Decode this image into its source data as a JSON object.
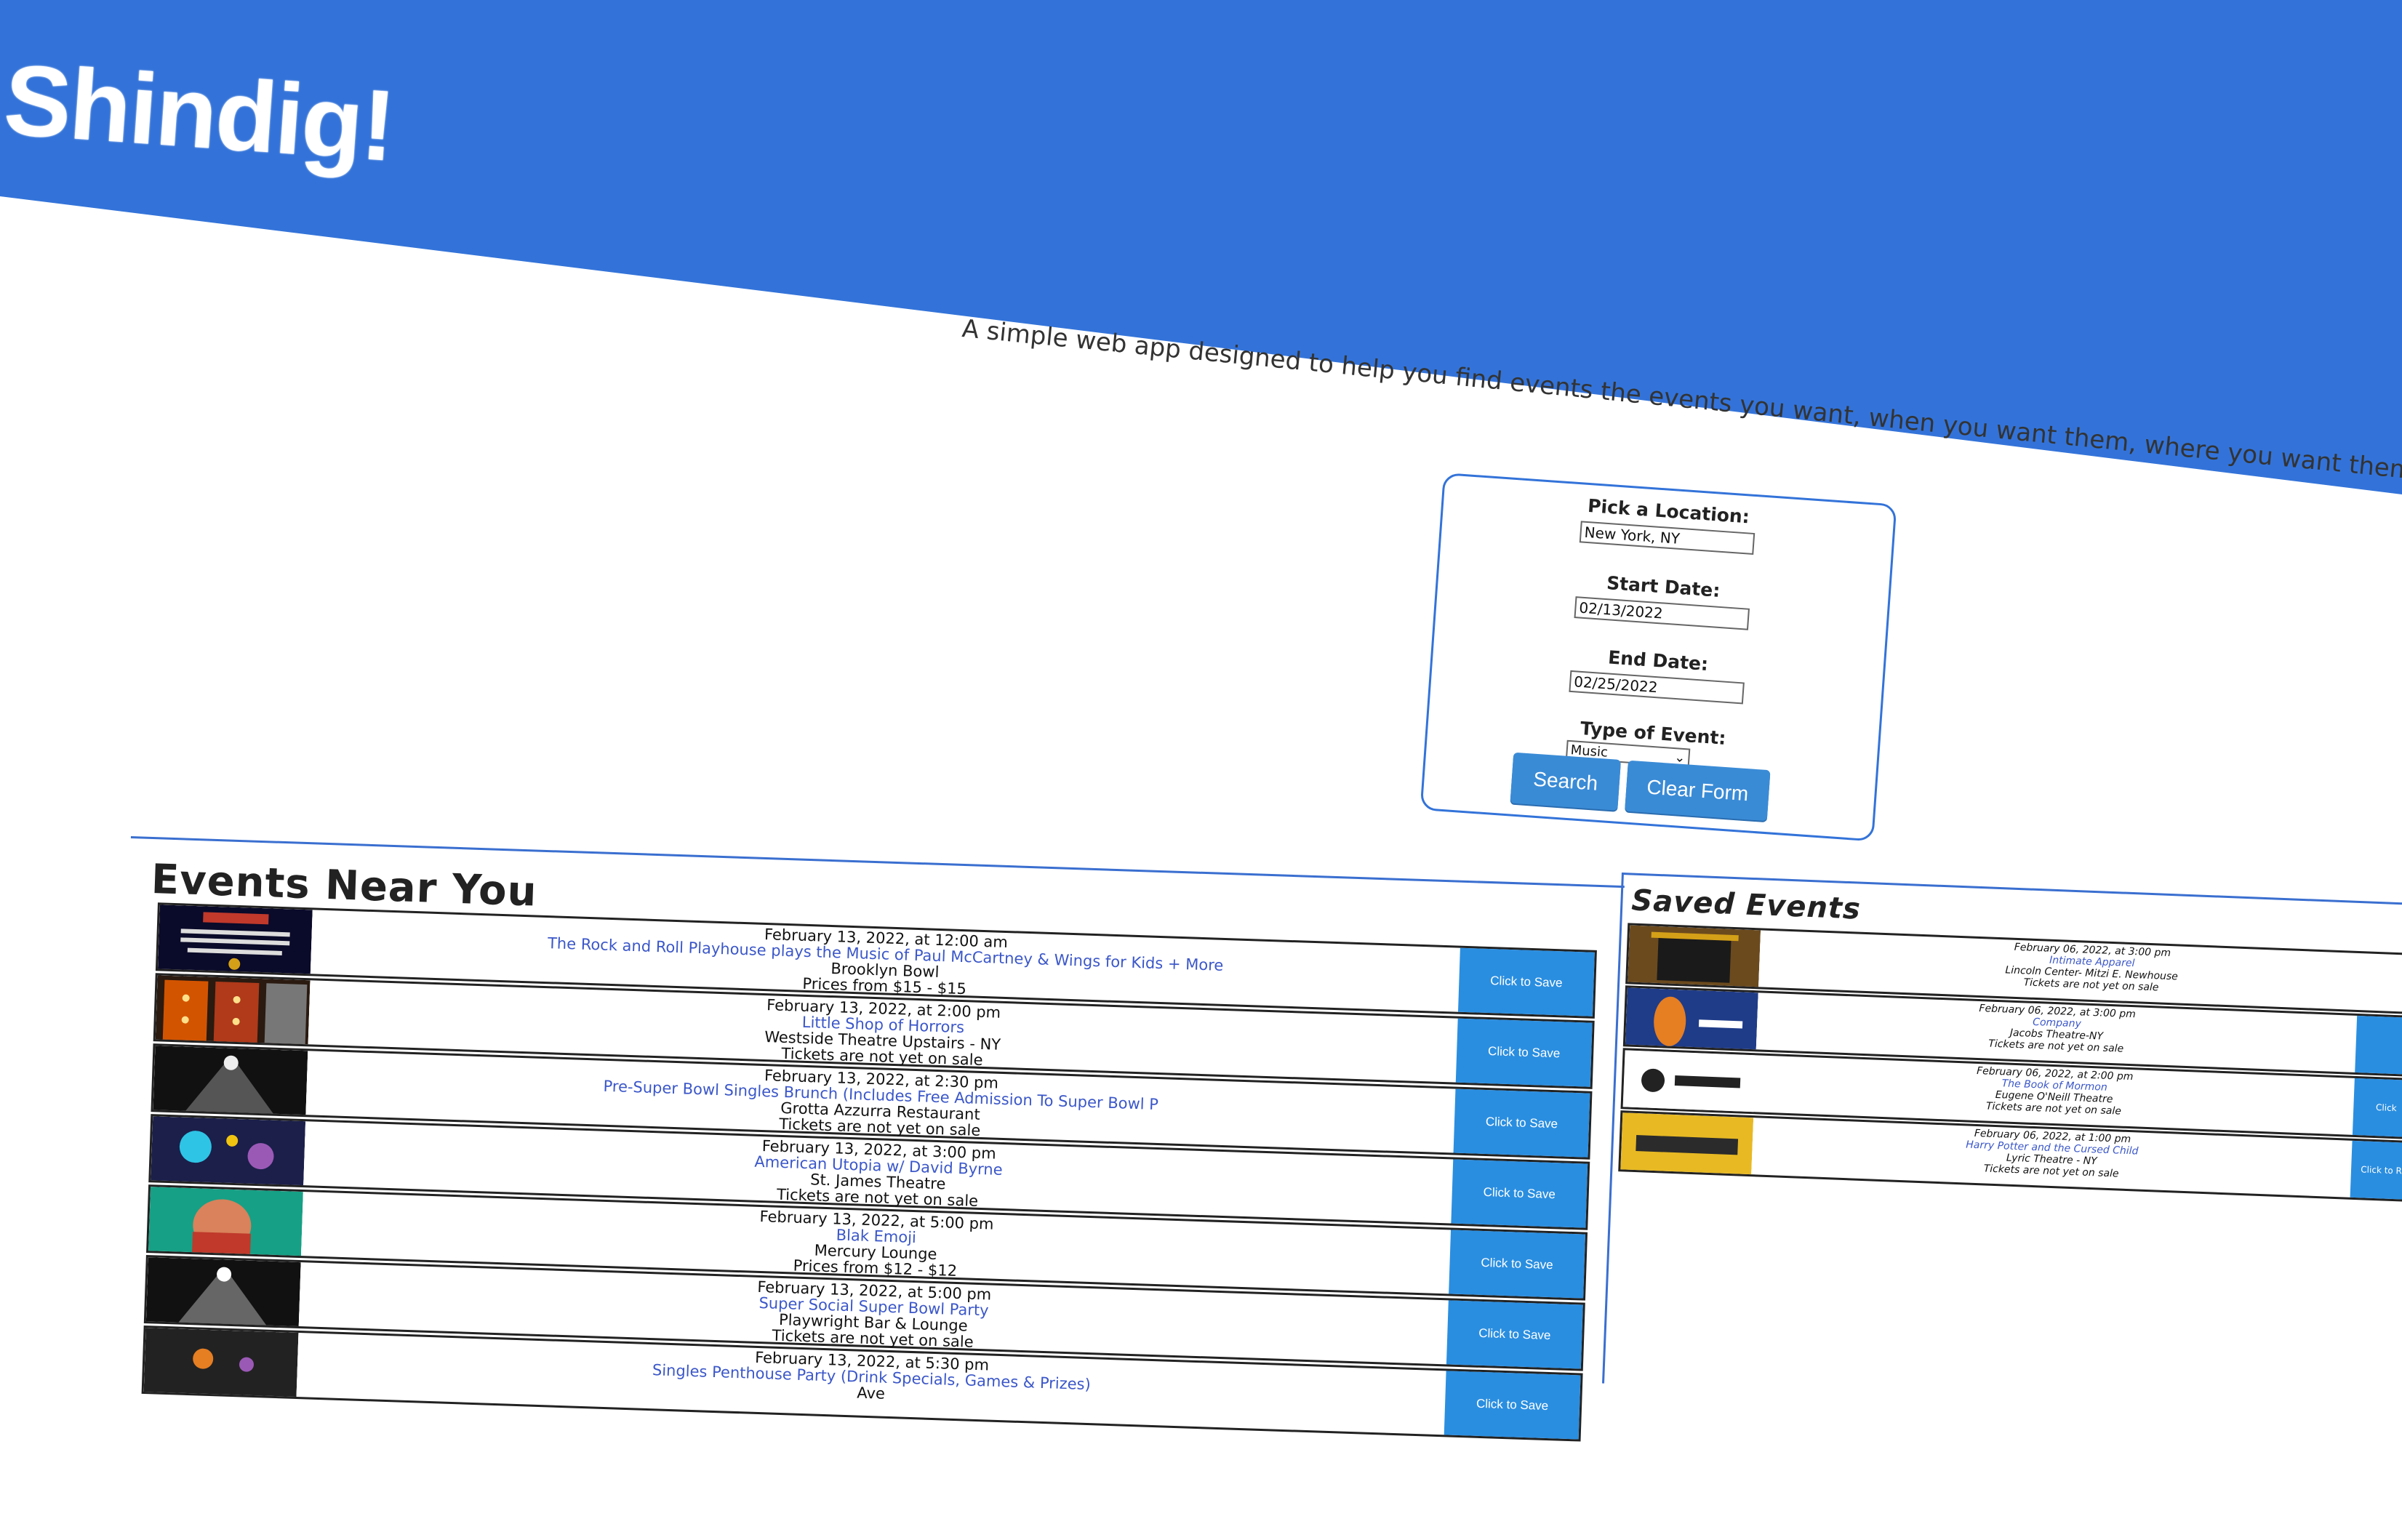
{
  "header": {
    "brand": "Shindig!",
    "tagline": "A simple web app designed to help you find events the events you want, when you want them, where you want them.",
    "band_color": "#3373d9"
  },
  "form": {
    "location_label": "Pick a Location:",
    "location_value": "New York, NY",
    "start_label": "Start Date:",
    "start_value": "02/13/2022",
    "end_label": "End Date:",
    "end_value": "02/25/2022",
    "type_label": "Type of Event:",
    "type_value": "Music",
    "search_label": "Search",
    "clear_label": "Clear Form"
  },
  "near": {
    "title": "Events Near You",
    "events": [
      {
        "date": "February 13, 2022, at 12:00 am",
        "name": "The Rock and Roll Playhouse plays the Music of Paul McCartney & Wings for Kids + More",
        "venue": "Brooklyn Bowl",
        "price": "Prices from $15 - $15",
        "save": "Click to Save",
        "thumb": "poster-icon"
      },
      {
        "date": "February 13, 2022, at 2:00 pm",
        "name": "Little Shop of Horrors",
        "venue": "Westside Theatre Upstairs - NY",
        "price": "Tickets are not yet on sale",
        "save": "Click to Save",
        "thumb": "marquee-icon"
      },
      {
        "date": "February 13, 2022, at 2:30 pm",
        "name": "Pre-Super Bowl Singles Brunch (Includes Free Admission To Super Bowl P",
        "venue": "Grotta Azzurra Restaurant",
        "price": "Tickets are not yet on sale",
        "save": "Click to Save",
        "thumb": "concert-icon"
      },
      {
        "date": "February 13, 2022, at 3:00 pm",
        "name": "American Utopia w/ David Byrne",
        "venue": "St. James Theatre",
        "price": "Tickets are not yet on sale",
        "save": "Click to Save",
        "thumb": "stage-lights-icon"
      },
      {
        "date": "February 13, 2022, at 5:00 pm",
        "name": "Blak Emoji",
        "venue": "Mercury Lounge",
        "price": "Prices from $12 - $12",
        "save": "Click to Save",
        "thumb": "performer-icon"
      },
      {
        "date": "February 13, 2022, at 5:00 pm",
        "name": "Super Social Super Bowl Party",
        "venue": "Playwright Bar & Lounge",
        "price": "Tickets are not yet on sale",
        "save": "Click to Save",
        "thumb": "concert-icon"
      },
      {
        "date": "February 13, 2022, at 5:30 pm",
        "name": "Singles Penthouse Party (Drink Specials, Games & Prizes)",
        "venue": "Ave",
        "price": "",
        "save": "Click to Save",
        "thumb": "party-icon"
      }
    ]
  },
  "saved": {
    "title": "Saved Events",
    "events": [
      {
        "date": "February 06, 2022, at 3:00 pm",
        "name": "Intimate Apparel",
        "venue": "Lincoln Center- Mitzi E. Newhouse",
        "price": "Tickets are not yet on sale",
        "save": "",
        "thumb": "theatre-icon"
      },
      {
        "date": "February 06, 2022, at 3:00 pm",
        "name": "Company",
        "venue": "Jacobs Theatre-NY",
        "price": "Tickets are not yet on sale",
        "save": "",
        "thumb": "company-poster-icon"
      },
      {
        "date": "February 06, 2022, at 2:00 pm",
        "name": "The Book of Mormon",
        "venue": "Eugene O'Neill Theatre",
        "price": "Tickets are not yet on sale",
        "save": "Click",
        "thumb": "mormon-logo-icon"
      },
      {
        "date": "February 06, 2022, at 1:00 pm",
        "name": "Harry Potter and the Cursed Child",
        "venue": "Lyric Theatre - NY",
        "price": "Tickets are not yet on sale",
        "save": "Click to Re",
        "thumb": "harry-potter-logo-icon"
      }
    ]
  }
}
